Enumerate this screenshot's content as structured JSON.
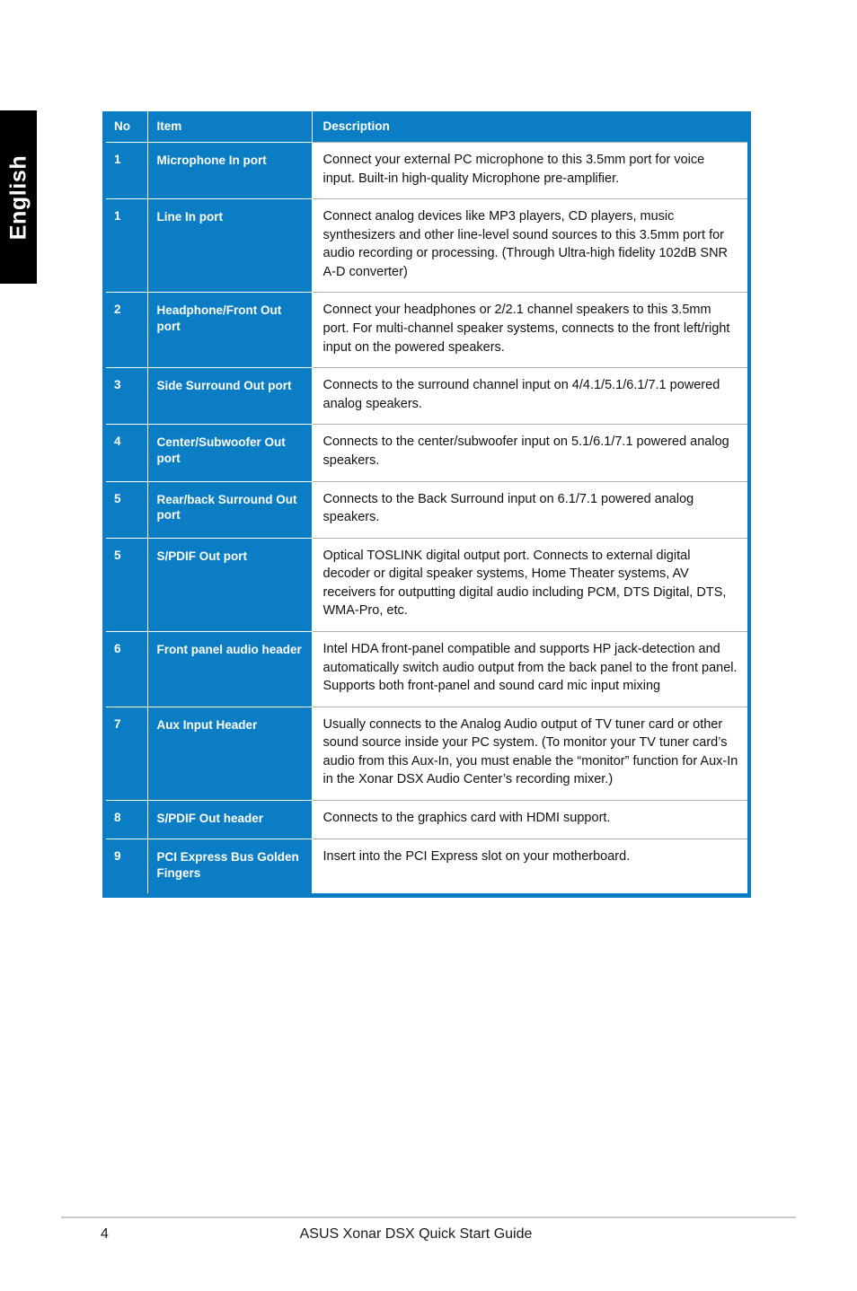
{
  "language_tab": {
    "label": "English"
  },
  "table": {
    "headers": {
      "no": "No",
      "item": "Item",
      "description": "Description"
    },
    "accent_color": "#0b7dc4",
    "rows": [
      {
        "no": "1",
        "item": "Microphone In port",
        "description": "Connect your external PC microphone to this 3.5mm port for voice input. Built-in high-quality Microphone pre-amplifier."
      },
      {
        "no": "1",
        "item": "Line In port",
        "description": "Connect analog devices like MP3 players, CD players, music synthesizers and other line-level sound sources to this 3.5mm port for audio recording or processing. (Through Ultra-high fidelity 102dB SNR A-D converter)"
      },
      {
        "no": "2",
        "item": "Headphone/Front Out port",
        "description": "Connect your headphones or 2/2.1 channel speakers to this 3.5mm port. For multi-channel speaker systems, connects to the front left/right input on the powered speakers."
      },
      {
        "no": "3",
        "item": "Side Surround Out port",
        "description": "Connects to the surround channel input on 4/4.1/5.1/6.1/7.1 powered analog speakers."
      },
      {
        "no": "4",
        "item": "Center/Subwoofer Out port",
        "description": "Connects to the center/subwoofer input on 5.1/6.1/7.1 powered analog speakers."
      },
      {
        "no": "5",
        "item": "Rear/back Surround Out port",
        "description": "Connects to the Back Surround input on 6.1/7.1 powered analog speakers."
      },
      {
        "no": "5",
        "item": "S/PDIF Out port",
        "description": "Optical TOSLINK digital output port. Connects to external digital decoder or digital speaker systems, Home Theater systems, AV receivers for outputting digital audio including PCM, DTS Digital, DTS, WMA-Pro, etc."
      },
      {
        "no": "6",
        "item": "Front panel audio header",
        "description": "Intel HDA front-panel compatible and supports HP jack-detection and automatically switch audio output from the back panel to the front panel.\nSupports both front-panel and sound card mic input mixing"
      },
      {
        "no": "7",
        "item": "Aux Input Header",
        "description": "Usually connects to the Analog Audio output of TV tuner card or other sound source inside your PC system. (To monitor your TV tuner card’s audio from this Aux-In, you must enable the “monitor” function for Aux-In in the Xonar DSX Audio Center’s recording mixer.)"
      },
      {
        "no": "8",
        "item": "S/PDIF Out header",
        "description": "Connects to the graphics card with HDMI support."
      },
      {
        "no": "9",
        "item": "PCI Express Bus Golden Fingers",
        "description": "Insert into the PCI Express slot on your motherboard."
      }
    ]
  },
  "footer": {
    "page_number": "4",
    "title": "ASUS Xonar DSX Quick Start Guide"
  }
}
